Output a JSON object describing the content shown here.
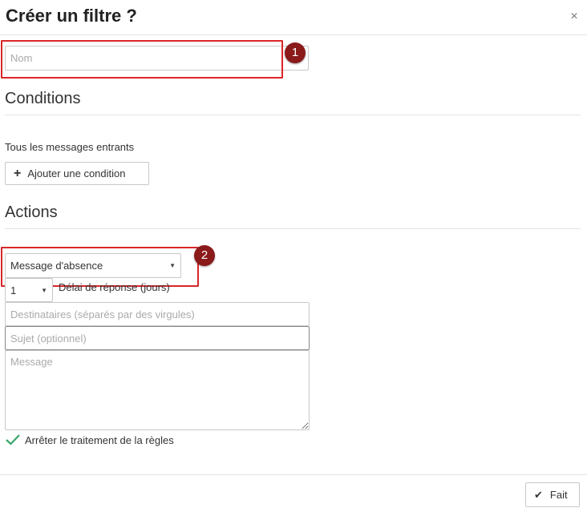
{
  "dialog": {
    "title": "Créer un filtre ?",
    "close_glyph": "×",
    "name_placeholder": "Nom"
  },
  "conditions": {
    "heading": "Conditions",
    "description": "Tous les messages entrants",
    "add_button_icon": "+",
    "add_button_label": "Ajouter une condition"
  },
  "actions": {
    "heading": "Actions",
    "action_select": "Message d'absence",
    "delay_value": "1",
    "delay_label": "Délai de réponse (jours)",
    "recipients_placeholder": "Destinataires (séparés par des virgules)",
    "subject_placeholder": "Sujet (optionnel)",
    "message_placeholder": "Message",
    "stop_processing_label": "Arrêter le traitement de la règles"
  },
  "annotations": {
    "badge_1": "1",
    "badge_2": "2"
  },
  "footer": {
    "done_label": "Fait",
    "done_icon": "✔"
  },
  "colors": {
    "annotation_red": "#d9262a",
    "badge": "#8b1a1a",
    "check_green": "#3aa56b"
  }
}
